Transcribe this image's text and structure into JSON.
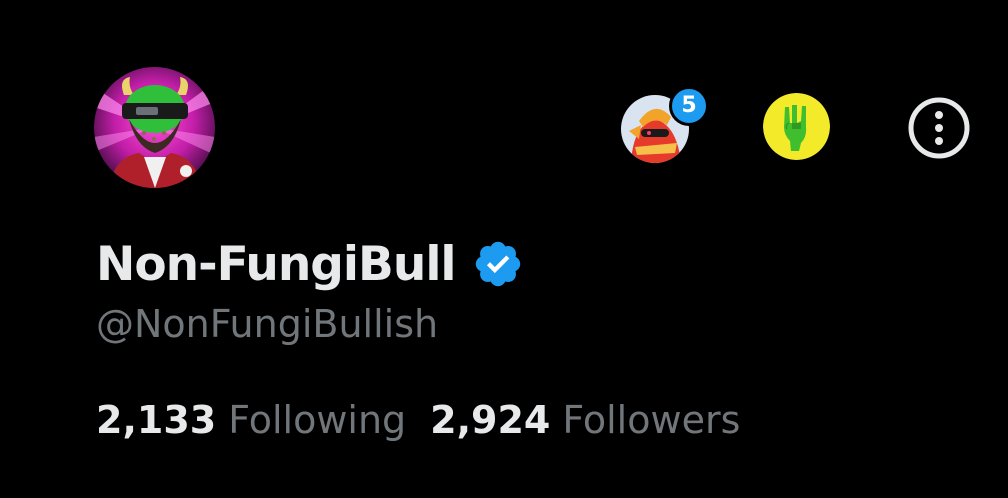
{
  "profile": {
    "display_name": "Non-FungiBull",
    "handle": "@NonFungiBullish",
    "verified_icon": "verified-badge-icon",
    "following_count": "2,133",
    "following_label": "Following",
    "followers_count": "2,924",
    "followers_label": "Followers"
  },
  "header": {
    "story_badge_count": "5",
    "more_icon": "more-options-icon",
    "community_icon": "rock-hand-icon"
  },
  "colors": {
    "background": "#000000",
    "primary_text": "#e7e9ea",
    "secondary_text": "#71767b",
    "accent": "#1d9bf0"
  }
}
